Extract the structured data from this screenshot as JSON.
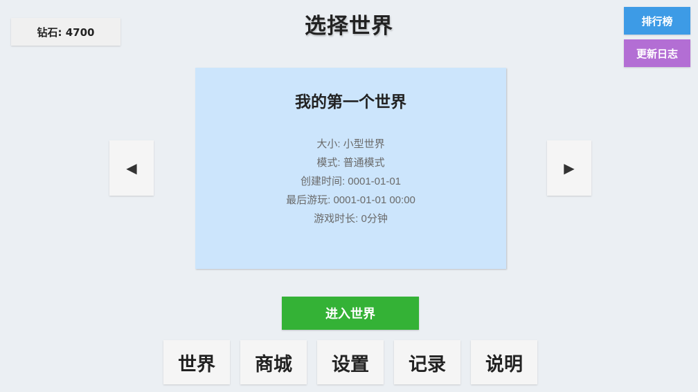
{
  "diamonds": {
    "label": "钻石: 4700"
  },
  "header": {
    "title": "选择世界"
  },
  "side_buttons": {
    "leaderboard": "排行榜",
    "changelog": "更新日志"
  },
  "world": {
    "name": "我的第一个世界",
    "size": "大小: 小型世界",
    "mode": "模式: 普通模式",
    "created": "创建时间: 0001-01-01",
    "last_played": "最后游玩: 0001-01-01 00:00",
    "play_time": "游戏时长: 0分钟"
  },
  "navigation": {
    "prev": "◀",
    "next": "▶"
  },
  "enter_button": "进入世界",
  "bottom_nav": {
    "items": [
      "世界",
      "商城",
      "设置",
      "记录",
      "说明"
    ]
  },
  "colors": {
    "background": "#ebeff3",
    "card": "#cce5fc",
    "leaderboard": "#3d9be6",
    "changelog": "#b36ed4",
    "enter": "#34b236"
  }
}
